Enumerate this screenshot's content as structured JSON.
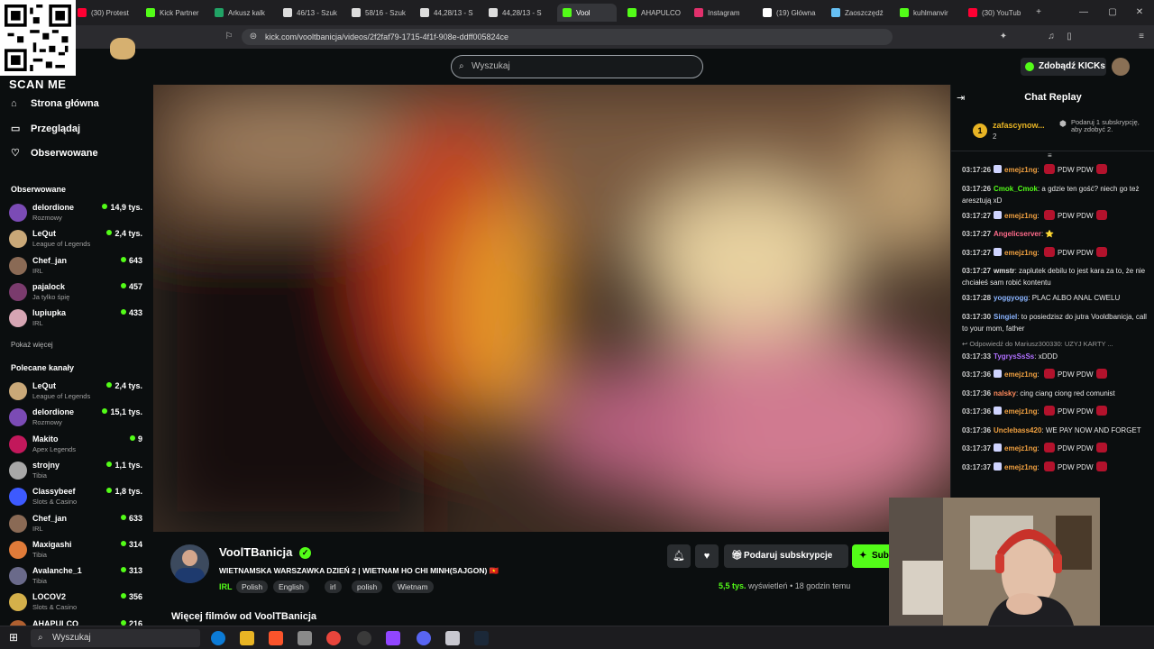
{
  "browser": {
    "tabs": [
      {
        "label": "(30) Protest",
        "color": "#ff0033"
      },
      {
        "label": "Kick Partner",
        "color": "#53fc18"
      },
      {
        "label": "Arkusz kalk",
        "color": "#21a366"
      },
      {
        "label": "46/13 - Szuk",
        "color": "#dddddd"
      },
      {
        "label": "58/16 - Szuk",
        "color": "#dddddd"
      },
      {
        "label": "44,28/13 - S",
        "color": "#dddddd"
      },
      {
        "label": "44,28/13 - S",
        "color": "#dddddd"
      },
      {
        "label": "Vool",
        "color": "#53fc18"
      },
      {
        "label": "AHAPULCO",
        "color": "#53fc18"
      },
      {
        "label": "Instagram",
        "color": "#e1306c"
      },
      {
        "label": "(19) Główna",
        "color": "#ffffff"
      },
      {
        "label": "Zaoszczędź",
        "color": "#66c0f4"
      },
      {
        "label": "kuhlmanvir",
        "color": "#53fc18"
      },
      {
        "label": "(30) YouTub",
        "color": "#ff0033"
      }
    ],
    "url": "kick.com/vooltbanicja/videos/2f2faf79-1715-4f1f-908e-ddff005824ce"
  },
  "overlay": {
    "scan_me": "SCAN ME"
  },
  "header": {
    "search_placeholder": "Wyszukaj",
    "kicks_button": "Zdobądź KICKs"
  },
  "sidebar": {
    "nav": [
      {
        "label": "Strona główna",
        "icon": "home-icon"
      },
      {
        "label": "Przeglądaj",
        "icon": "browse-icon"
      },
      {
        "label": "Obserwowane",
        "icon": "heart-icon"
      }
    ],
    "followed_heading": "Obserwowane",
    "followed": [
      {
        "name": "delordione",
        "category": "Rozmowy",
        "viewers": "14,9 tys.",
        "color": "#7b4bb5"
      },
      {
        "name": "LeQut",
        "category": "League of Legends",
        "viewers": "2,4 tys.",
        "color": "#c9a878"
      },
      {
        "name": "Chef_jan",
        "category": "IRL",
        "viewers": "643",
        "color": "#8a6a55"
      },
      {
        "name": "pajalock",
        "category": "Ja tylko śpię",
        "viewers": "457",
        "color": "#7a3b6d"
      },
      {
        "name": "lupiupka",
        "category": "IRL",
        "viewers": "433",
        "color": "#d6a5b3"
      }
    ],
    "show_more": "Pokaż więcej",
    "recommended_heading": "Polecane kanały",
    "recommended": [
      {
        "name": "LeQut",
        "category": "League of Legends",
        "viewers": "2,4 tys.",
        "color": "#c9a878"
      },
      {
        "name": "delordione",
        "category": "Rozmowy",
        "viewers": "15,1 tys.",
        "color": "#7b4bb5"
      },
      {
        "name": "Makito",
        "category": "Apex Legends",
        "viewers": "9",
        "color": "#c2185b"
      },
      {
        "name": "strojny",
        "category": "Tibia",
        "viewers": "1,1 tys.",
        "color": "#a8a8a8"
      },
      {
        "name": "Classybeef",
        "category": "Slots & Casino",
        "viewers": "1,8 tys.",
        "color": "#3d5afe"
      },
      {
        "name": "Chef_jan",
        "category": "IRL",
        "viewers": "633",
        "color": "#8a6a55"
      },
      {
        "name": "Maxigashi",
        "category": "Tibia",
        "viewers": "314",
        "color": "#e07b39"
      },
      {
        "name": "Avalanche_1",
        "category": "Tibia",
        "viewers": "313",
        "color": "#6a6a8a"
      },
      {
        "name": "LOCOV2",
        "category": "Slots & Casino",
        "viewers": "356",
        "color": "#d4b04a"
      },
      {
        "name": "AHAPULCO",
        "category": "",
        "viewers": "216",
        "color": "#b06030"
      }
    ]
  },
  "video_info": {
    "channel": "VoolTBanicja",
    "title": "WIETNAMSKA WARSZAWKA DZIEŃ 2 | WIETNAM HO CHI MINH(SAJGON) 🇻🇳",
    "category": "IRL",
    "tags": [
      "Polish",
      "English",
      "irl",
      "polish",
      "Wietnam"
    ],
    "gift_button": "Podaruj subskrypcje",
    "sub_button": "Sub",
    "views_value": "5,5 tys.",
    "views_label": "wyświetleń",
    "time_ago": "18 godzin temu",
    "more_videos": "Więcej filmów od VoolTBanicja"
  },
  "chat": {
    "title": "Chat Replay",
    "gifter": {
      "rank": "1",
      "name": "zafascynow...",
      "count": "2",
      "note": "Podaruj 1 subskrypcję, aby zdobyć 2."
    },
    "messages": [
      {
        "ts": "03:17:26",
        "user": "emejz1ng",
        "color": "#f0a040",
        "text": "PDW PDW",
        "badge": true,
        "emote": true
      },
      {
        "ts": "03:17:26",
        "user": "Cmok_Cmok",
        "color": "#53fc18",
        "text": "a gdzie ten gość? niech go też aresztują xD",
        "badge": false,
        "emote": false
      },
      {
        "ts": "03:17:27",
        "user": "emejz1ng",
        "color": "#f0a040",
        "text": "PDW PDW",
        "badge": true,
        "emote": true
      },
      {
        "ts": "03:17:27",
        "user": "Angelicserver",
        "color": "#ff6b8a",
        "text": "⭐",
        "badge": false,
        "emote": false
      },
      {
        "ts": "03:17:27",
        "user": "emejz1ng",
        "color": "#f0a040",
        "text": "PDW PDW",
        "badge": true,
        "emote": true
      },
      {
        "ts": "03:17:27",
        "user": "wmstr",
        "color": "#e6e6e6",
        "text": "zaplutek debilu to jest kara za to, że nie chciałeś sam robić kontentu",
        "badge": false,
        "emote": false
      },
      {
        "ts": "03:17:28",
        "user": "yoggyogg",
        "color": "#8ab4ff",
        "text": "PLAC ALBO ANAL CWELU",
        "badge": false,
        "emote": false
      },
      {
        "ts": "03:17:30",
        "user": "Singiel",
        "color": "#8ab4ff",
        "text": "to posiedzisz do jutra Vooldbanicja, call to your mom, father",
        "badge": false,
        "emote": false
      },
      {
        "ts": "",
        "user": "",
        "color": "#999999",
        "text": "↩ Odpowiedź do Mariusz300330: UZYJ KARTY ...",
        "badge": false,
        "emote": false
      },
      {
        "ts": "03:17:33",
        "user": "TygrysSsSs",
        "color": "#b070ff",
        "text": "xDDD",
        "badge": false,
        "emote": false
      },
      {
        "ts": "03:17:36",
        "user": "emejz1ng",
        "color": "#f0a040",
        "text": "PDW PDW",
        "badge": true,
        "emote": true
      },
      {
        "ts": "03:17:36",
        "user": "nalsky",
        "color": "#ff8a5c",
        "text": "cing ciang ciong red comunist",
        "badge": false,
        "emote": false
      },
      {
        "ts": "03:17:36",
        "user": "emejz1ng",
        "color": "#f0a040",
        "text": "PDW PDW",
        "badge": true,
        "emote": true
      },
      {
        "ts": "03:17:36",
        "user": "Unclebass420",
        "color": "#f0a040",
        "text": "WE PAY NOW AND FORGET",
        "badge": false,
        "emote": false
      },
      {
        "ts": "03:17:37",
        "user": "emejz1ng",
        "color": "#f0a040",
        "text": "PDW PDW",
        "badge": true,
        "emote": true
      },
      {
        "ts": "03:17:37",
        "user": "emejz1ng",
        "color": "#f0a040",
        "text": "PDW PDW",
        "badge": true,
        "emote": true
      }
    ]
  },
  "taskbar": {
    "search": "Wyszukaj"
  }
}
